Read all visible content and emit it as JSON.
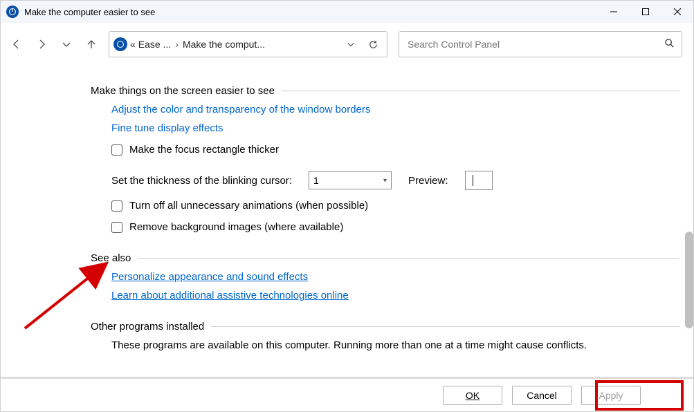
{
  "window": {
    "title": "Make the computer easier to see"
  },
  "breadcrumb": {
    "prefix": "«",
    "item1": "Ease ...",
    "item2": "Make the comput..."
  },
  "search": {
    "placeholder": "Search Control Panel"
  },
  "sections": {
    "easier": {
      "title": "Make things on the screen easier to see",
      "link_color": "Adjust the color and transparency of the window borders",
      "link_finetune": "Fine tune display effects",
      "check_focus": "Make the focus rectangle thicker",
      "cursor_label": "Set the thickness of the blinking cursor:",
      "cursor_value": "1",
      "preview_label": "Preview:",
      "check_anim": "Turn off all unnecessary animations (when possible)",
      "check_bg": "Remove background images (where available)"
    },
    "seealso": {
      "title": "See also",
      "link_personalize": "Personalize appearance and sound effects",
      "link_assistive": "Learn about additional assistive technologies online"
    },
    "other": {
      "title": "Other programs installed",
      "desc": "These programs are available on this computer. Running more than one at a time might cause conflicts."
    }
  },
  "buttons": {
    "ok": "OK",
    "cancel": "Cancel",
    "apply": "Apply"
  }
}
